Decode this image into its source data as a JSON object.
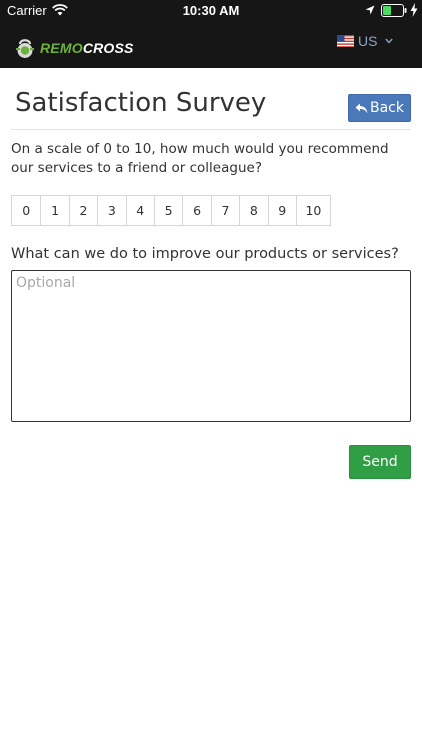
{
  "status_bar": {
    "carrier": "Carrier",
    "time": "10:30 AM",
    "icons": [
      "wifi-icon",
      "location-icon",
      "battery-icon",
      "charging-bolt-icon"
    ]
  },
  "header": {
    "logo": {
      "text_part1": "REMO",
      "text_part2": "CROSS",
      "icon": "kettlebell-icon"
    },
    "language": {
      "code": "US",
      "icon": "us-flag-icon",
      "dropdown_icon": "chevron-down-icon"
    }
  },
  "page": {
    "title": "Satisfaction Survey",
    "back_label": "Back"
  },
  "survey": {
    "question_rating": "On a scale of 0 to 10, how much would you recommend our services to a friend or colleague?",
    "scale": [
      "0",
      "1",
      "2",
      "3",
      "4",
      "5",
      "6",
      "7",
      "8",
      "9",
      "10"
    ],
    "question_feedback": "What can we do to improve our products or services?",
    "feedback_placeholder": "Optional",
    "send_label": "Send"
  },
  "colors": {
    "header_bg": "#161616",
    "logo_green": "#6ab23b",
    "back_button": "#4a78b8",
    "send_button": "#2f9e44",
    "lang_text": "#8ea3c8"
  }
}
